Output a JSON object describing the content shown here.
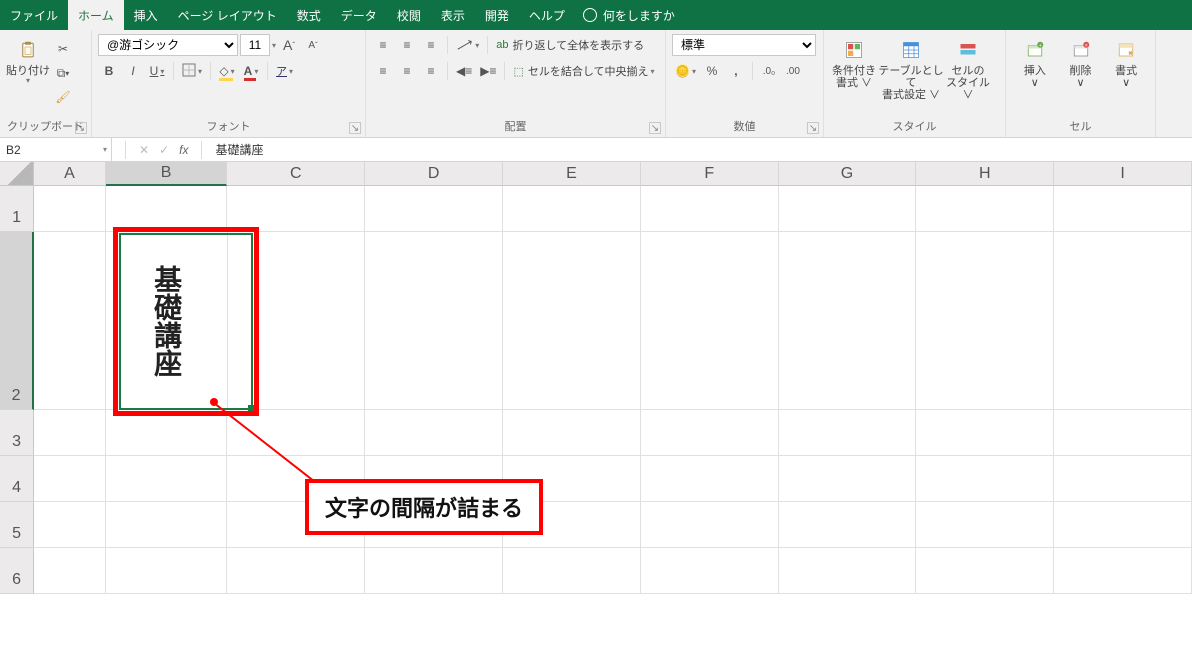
{
  "tabs": {
    "file": "ファイル",
    "home": "ホーム",
    "insert": "挿入",
    "pagelayout": "ページ レイアウト",
    "formulas": "数式",
    "data": "データ",
    "review": "校閲",
    "view": "表示",
    "developer": "開発",
    "help": "ヘルプ",
    "tell": "何をしますか"
  },
  "ribbon": {
    "clipboard": {
      "paste": "貼り付け",
      "label": "クリップボード"
    },
    "font": {
      "name": "@游ゴシック",
      "size": "11",
      "label": "フォント",
      "ruby": "ア",
      "a_big": "A",
      "a_small": "A",
      "bold": "B",
      "italic": "I",
      "underline": "U"
    },
    "alignment": {
      "wrap": "折り返して全体を表示する",
      "merge": "セルを結合して中央揃え",
      "label": "配置",
      "ab": "ab",
      "ce": "c≡"
    },
    "number": {
      "format": "標準",
      "label": "数値",
      "percent": "%",
      "comma": ",",
      "inc": ".0₀",
      "dec": ".00"
    },
    "styles": {
      "cond": "条件付き\n書式 ∨",
      "table": "テーブルとして\n書式設定 ∨",
      "cell": "セルの\nスタイル ∨",
      "label": "スタイル"
    },
    "cells": {
      "insert": "挿入\n∨",
      "delete": "削除\n∨",
      "format": "書式\n∨",
      "label": "セル"
    }
  },
  "namebox": {
    "ref": "B2",
    "formula": "基礎講座"
  },
  "columns": [
    "A",
    "B",
    "C",
    "D",
    "E",
    "F",
    "G",
    "H",
    "I"
  ],
  "rows": [
    "1",
    "2",
    "3",
    "4",
    "5",
    "6"
  ],
  "cellB2": "基礎講座",
  "callout": "文字の間隔が詰まる",
  "fx": "fx",
  "x": "✕",
  "check": "✓"
}
